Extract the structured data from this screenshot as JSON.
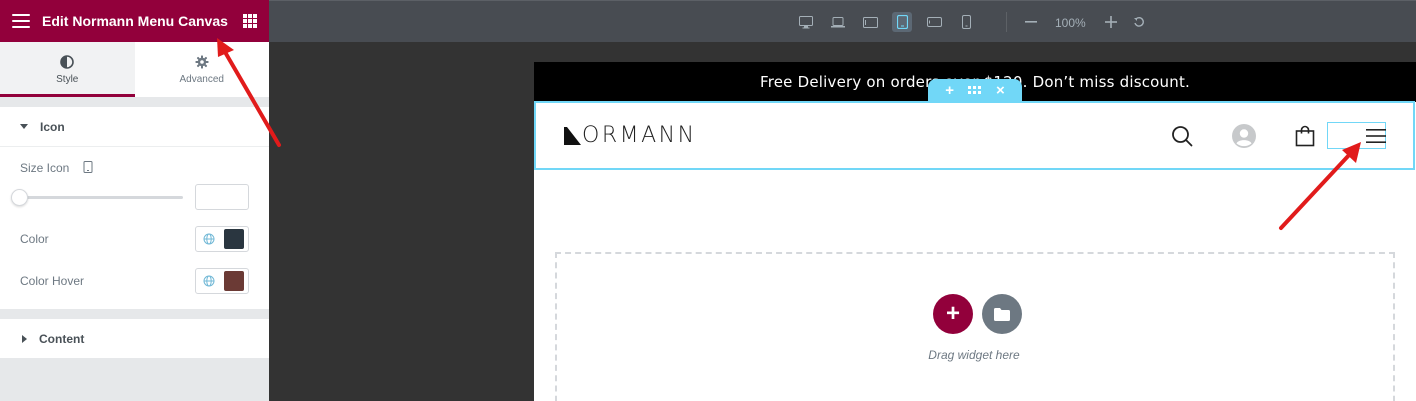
{
  "panel": {
    "title": "Edit Normann Menu Canvas",
    "tabs": [
      {
        "label": "Style",
        "icon": "half-circle-icon",
        "active": true
      },
      {
        "label": "Advanced",
        "icon": "gear-icon",
        "active": false
      }
    ],
    "sections": {
      "icon": {
        "label": "Icon",
        "size_label": "Size Icon",
        "size_value": "",
        "color_label": "Color",
        "color_hover_label": "Color Hover"
      },
      "content": {
        "label": "Content"
      }
    }
  },
  "toolbar": {
    "zoom": "100%"
  },
  "preview": {
    "promo_text": "Free Delivery on orders over $120. Don’t miss discount.",
    "logo_text": "ORMANN",
    "drag_text": "Drag widget here"
  },
  "colors": {
    "brand": "#92003b",
    "icon_color": "#2a3640",
    "icon_hover_color": "#6b3a35",
    "selection": "#71d7f7",
    "annotation_arrow": "#e11b1b"
  }
}
